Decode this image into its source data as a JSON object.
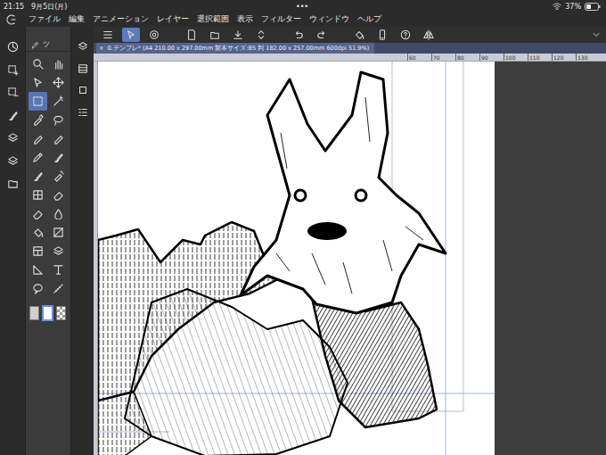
{
  "status_bar": {
    "time": "21:15",
    "date": "9月5日(月)",
    "dots": "•••",
    "battery": "37%"
  },
  "menu": [
    "ファイル",
    "編集",
    "アニメーション",
    "レイヤー",
    "選択範囲",
    "表示",
    "フィルター",
    "ウィンドウ",
    "ヘルプ"
  ],
  "command_bar": [
    {
      "selected": false
    },
    {
      "selected": true
    },
    {
      "selected": false
    },
    {
      "selected": false
    },
    {
      "selected": false
    },
    {
      "selected": false
    },
    {
      "selected": false
    },
    {
      "selected": false
    },
    {
      "selected": false
    },
    {
      "selected": false
    },
    {
      "selected": false
    },
    {
      "selected": false
    },
    {
      "selected": false
    }
  ],
  "tool_panel": {
    "header": "ツ",
    "tools": [
      {
        "selected": false
      },
      {
        "selected": false
      },
      {
        "selected": false
      },
      {
        "selected": false
      },
      {
        "selected": true
      },
      {
        "selected": false
      },
      {
        "selected": false
      },
      {
        "selected": false
      },
      {
        "selected": false
      },
      {
        "selected": false
      },
      {
        "selected": false
      },
      {
        "selected": false
      },
      {
        "selected": false
      },
      {
        "selected": false
      },
      {
        "selected": false
      },
      {
        "selected": false
      },
      {
        "selected": false
      },
      {
        "selected": false
      },
      {
        "selected": false
      },
      {
        "selected": false
      },
      {
        "selected": false
      },
      {
        "selected": false
      },
      {
        "selected": false
      },
      {
        "selected": false
      },
      {
        "selected": false
      },
      {
        "selected": false
      }
    ],
    "colors": [
      {
        "kind": "fill",
        "color": "#cfcfcf",
        "selected": false
      },
      {
        "kind": "fill",
        "color": "#ffffff",
        "selected": true
      },
      {
        "kind": "checker",
        "selected": false
      }
    ]
  },
  "document_tab": {
    "close": "×",
    "title": "0.テンプレ* (A4 210.00 x 297.00mm 製本サイズ:B5 判 182.00 x 257.00mm 600dpi 51.9%)"
  },
  "ruler": [
    "60",
    "70",
    "80",
    "90",
    "100",
    "110",
    "120",
    "130"
  ]
}
